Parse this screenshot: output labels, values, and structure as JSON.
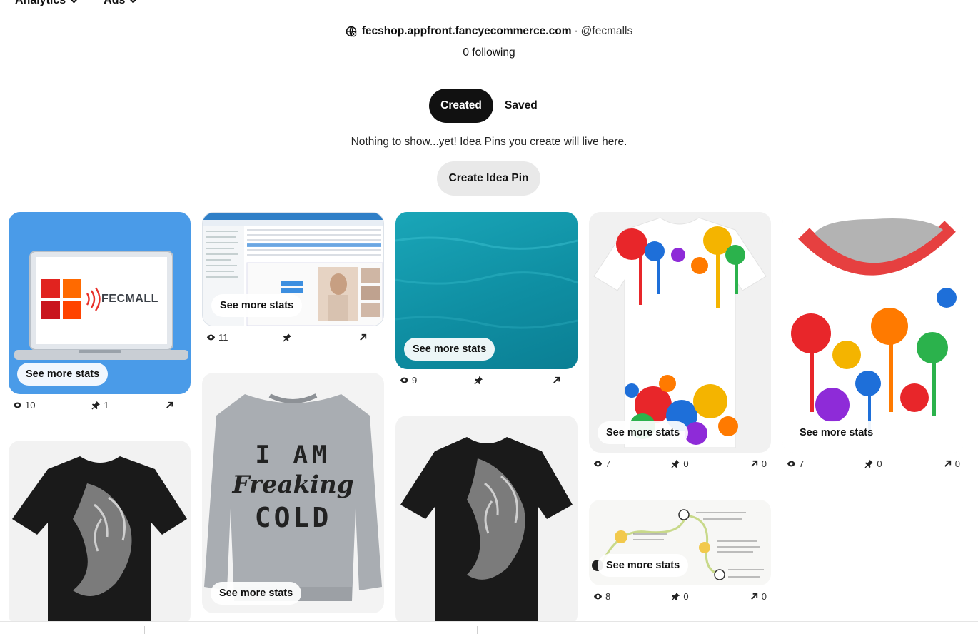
{
  "nav": {
    "items": [
      {
        "label": "Analytics"
      },
      {
        "label": "Ads"
      }
    ]
  },
  "profile": {
    "domain": "fecshop.appfront.fancyecommerce.com",
    "separator": "·",
    "handle": "@fecmalls",
    "following": "0 following"
  },
  "tabs": {
    "created": "Created",
    "saved": "Saved"
  },
  "empty_state": {
    "message": "Nothing to show...yet! Idea Pins you create will live here.",
    "create_button": "Create Idea Pin"
  },
  "see_more_label": "See more stats",
  "pins": [
    {
      "name": "pin-fecmall-laptop",
      "views": "10",
      "saves": "1",
      "outbound": "—",
      "image": "fecmall-laptop",
      "brand_text": "FECMALL"
    },
    {
      "name": "pin-admin-screenshot",
      "views": "11",
      "saves": "—",
      "outbound": "—",
      "image": "admin-screenshot"
    },
    {
      "name": "pin-teal-water",
      "views": "9",
      "saves": "—",
      "outbound": "—",
      "image": "teal-water"
    },
    {
      "name": "pin-paint-tshirt",
      "views": "7",
      "saves": "0",
      "outbound": "0",
      "image": "paint-splatter-tshirt"
    },
    {
      "name": "pin-paint-closeup",
      "views": "7",
      "saves": "0",
      "outbound": "0",
      "image": "paint-splatter-closeup"
    },
    {
      "name": "pin-lion-tshirt-1",
      "image": "lion-tshirt"
    },
    {
      "name": "pin-sweatshirt",
      "image": "sweatshirt",
      "print_text": [
        "I AM",
        "Freaking",
        "COLD"
      ]
    },
    {
      "name": "pin-lion-tshirt-2",
      "image": "lion-tshirt"
    },
    {
      "name": "pin-facebook-infographic",
      "views": "8",
      "saves": "0",
      "outbound": "0",
      "image": "facebook-infographic"
    }
  ],
  "icons": {
    "views": "eye-icon",
    "saves": "pin-icon",
    "outbound": "outbound-arrow-icon",
    "domain": "globe-icon"
  },
  "colors": {
    "accent_dark": "#111111",
    "button_gray": "#e9e9e9",
    "fecmall_blue": "#4a9be8",
    "water_teal": "#14a1b3"
  }
}
